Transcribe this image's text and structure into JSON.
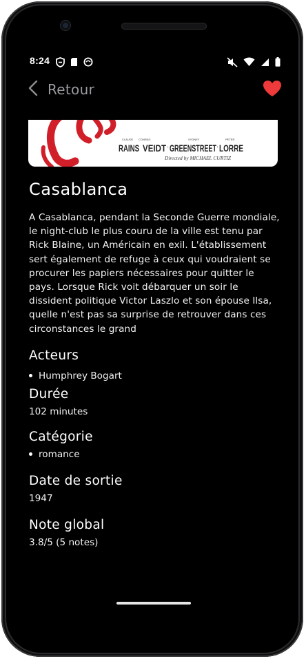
{
  "status_bar": {
    "time": "8:24"
  },
  "header": {
    "back_label": "Retour"
  },
  "poster": {
    "credit_names": [
      "RAINS",
      "VEIDT",
      "GREENSTREET",
      "LORRE"
    ],
    "credit_firsts": [
      "CLAUDE",
      "CONRAD",
      "SYDNEY",
      "PETER"
    ],
    "director_credit": "Directed by MICHAEL CURTIZ"
  },
  "movie": {
    "title": "Casablanca",
    "synopsis": "A Casablanca, pendant la Seconde Guerre mondiale, le night-club le plus couru de la ville est tenu par Rick Blaine, un Américain en exil. L'établissement sert également de refuge à ceux qui voudraient se procurer les papiers nécessaires pour quitter le pays. Lorsque Rick voit débarquer un soir le dissident politique Victor Laszlo et son épouse Ilsa, quelle n'est pas sa surprise de retrouver dans ces circonstances le grand"
  },
  "sections": {
    "actors_heading": "Acteurs",
    "actors": [
      "Humphrey Bogart"
    ],
    "duration_heading": "Durée",
    "duration_value": "102 minutes",
    "category_heading": "Catégorie",
    "categories": [
      "romance"
    ],
    "release_heading": "Date de sortie",
    "release_value": "1947",
    "rating_heading": "Note global",
    "rating_value": "3.8/5 (5 notes)"
  },
  "colors": {
    "background": "#000000",
    "heart": "#ee3a3a",
    "back_text": "#9a9a9f",
    "poster_red": "#d11f2a"
  }
}
